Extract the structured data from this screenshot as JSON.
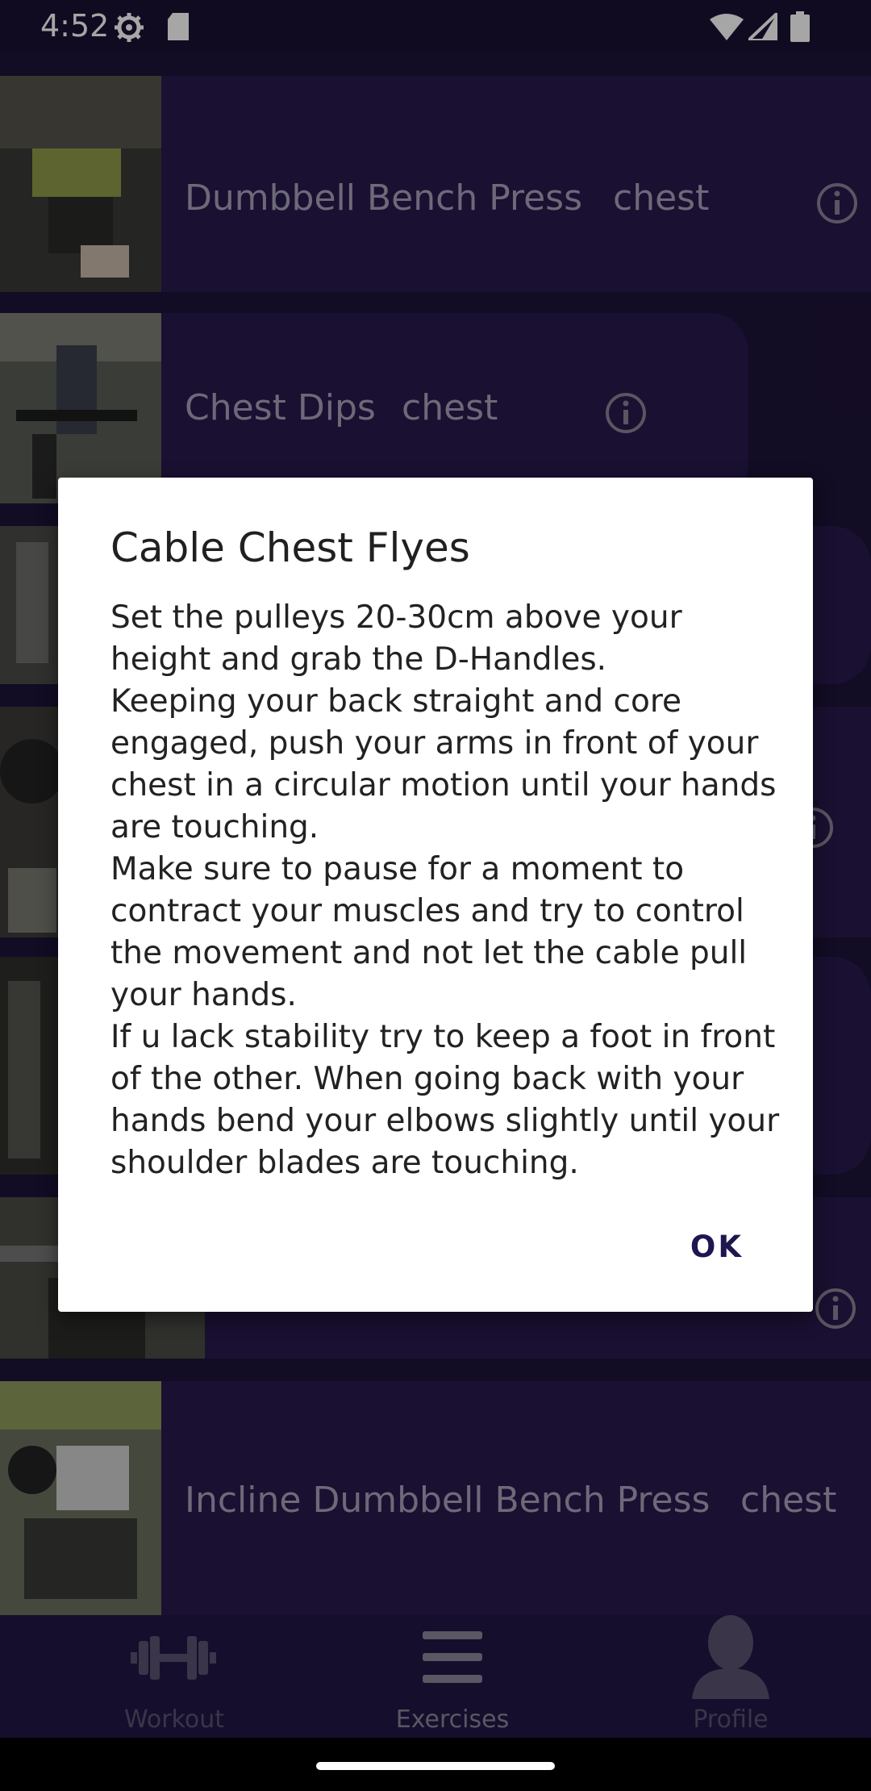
{
  "status_bar": {
    "time": "4:52",
    "icons": [
      "gear-icon",
      "sd-card-icon",
      "wifi-icon",
      "signal-icon",
      "battery-icon"
    ]
  },
  "exercises": [
    {
      "name": "Dumbbell Bench Press",
      "muscle": "chest"
    },
    {
      "name": "Chest Dips",
      "muscle": "chest"
    },
    {
      "name": "",
      "muscle": ""
    },
    {
      "name": "",
      "muscle": ""
    },
    {
      "name": "",
      "muscle": ""
    },
    {
      "name": "",
      "muscle": ""
    },
    {
      "name": "Incline Dumbbell Bench Press",
      "muscle": "chest"
    }
  ],
  "dialog": {
    "title": "Cable Chest Flyes",
    "paragraphs": [
      "Set the pulleys 20-30cm above your height and grab the D-Handles.",
      "Keeping your back straight and core engaged, push your arms in front of your chest in a circular motion until your hands are touching.",
      "Make sure to pause for a moment to contract your muscles and try to control the movement and not let the cable pull your hands.",
      "If u lack stability try to keep a foot in front of the other. When going back with your hands bend your elbows slightly until your shoulder blades are touching."
    ],
    "ok_label": "OK"
  },
  "bottom_nav": [
    {
      "label": "Workout",
      "icon": "dumbbell-icon",
      "active": false
    },
    {
      "label": "Exercises",
      "icon": "menu-icon",
      "active": true
    },
    {
      "label": "Profile",
      "icon": "person-icon",
      "active": false
    }
  ],
  "colors": {
    "background": "#1d1338",
    "card": "#281a4c",
    "status_bar": "#1b1235",
    "dialog": "#ffffff",
    "accent": "#1e1650"
  }
}
